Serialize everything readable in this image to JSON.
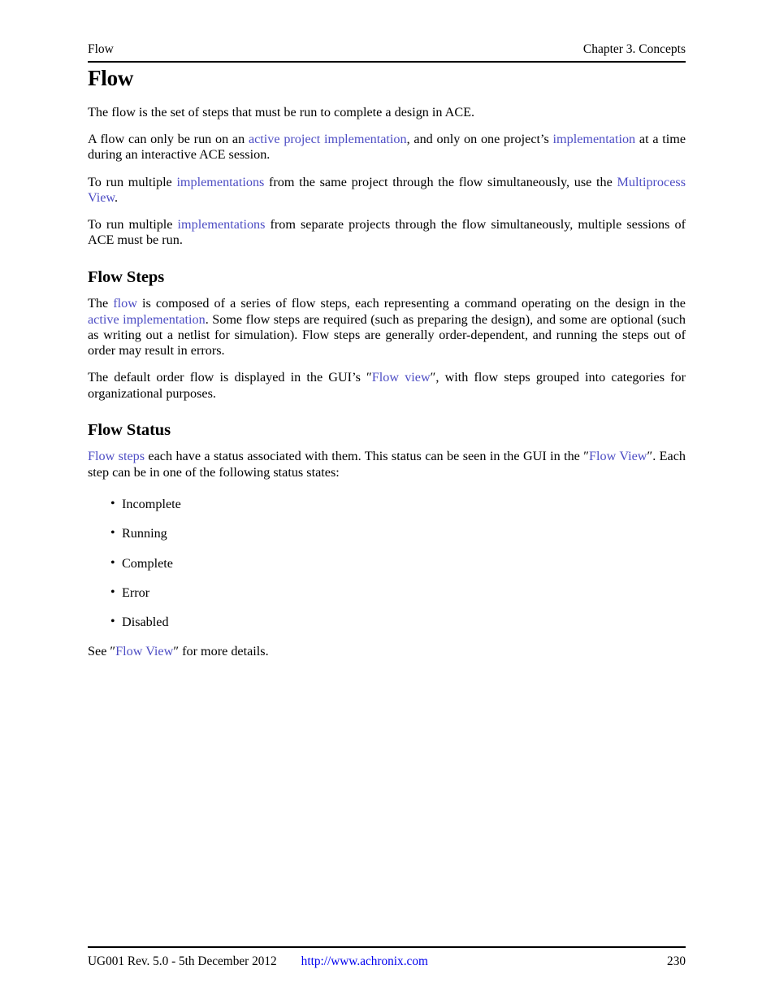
{
  "header": {
    "left": "Flow",
    "right": "Chapter 3. Concepts"
  },
  "title": "Flow",
  "paragraphs": {
    "intro": {
      "t1": "The flow is the set of steps that must be run to complete a design in ACE."
    },
    "p2": {
      "t1": "A flow can only be run on an ",
      "link1": "active project implementation",
      "t2": ", and only on one project’s ",
      "link2": "implementation",
      "t3": " at a time during an interactive ACE session."
    },
    "p3": {
      "t1": "To run multiple ",
      "link1": "implementations",
      "t2": " from the same project through the flow simultaneously, use the ",
      "link2": "Multiprocess View",
      "t3": "."
    },
    "p4": {
      "t1": "To run multiple ",
      "link1": "implementations",
      "t2": " from separate projects through the flow simultaneously, multiple sessions of ACE must be run."
    }
  },
  "flow_steps": {
    "heading": "Flow Steps",
    "p1": {
      "t1": "The ",
      "link1": "flow",
      "t2": " is composed of a series of flow steps, each representing a command operating on the design in the ",
      "link2": "active implementation",
      "t3": ". Some flow steps are required (such as preparing the design), and some are optional (such as writing out a netlist for simulation).  Flow steps are generally order-dependent, and running the steps out of order may result in errors."
    },
    "p2": {
      "t1": "The default order flow is displayed in the GUI’s ″",
      "link1": "Flow view",
      "t2": "″, with flow steps grouped into categories for organizational purposes."
    }
  },
  "flow_status": {
    "heading": "Flow Status",
    "p1": {
      "link1": "Flow steps",
      "t1": " each have a status associated with them. This status can be seen in the GUI in the ″",
      "link2": "Flow View",
      "t2": "″. Each step can be in one of the following status states:"
    },
    "bullet_char": "•",
    "states": [
      "Incomplete",
      "Running",
      "Complete",
      "Error",
      "Disabled"
    ],
    "see_more": {
      "t1": "See ″",
      "link1": "Flow View",
      "t2": "″ for more details."
    }
  },
  "footer": {
    "note": "UG001 Rev. 5.0 - 5th December 2012",
    "url": "http://www.achronix.com",
    "page": "230"
  },
  "colors": {
    "xref": "#4d4dc4",
    "url": "#0000ee",
    "text": "#000000"
  }
}
